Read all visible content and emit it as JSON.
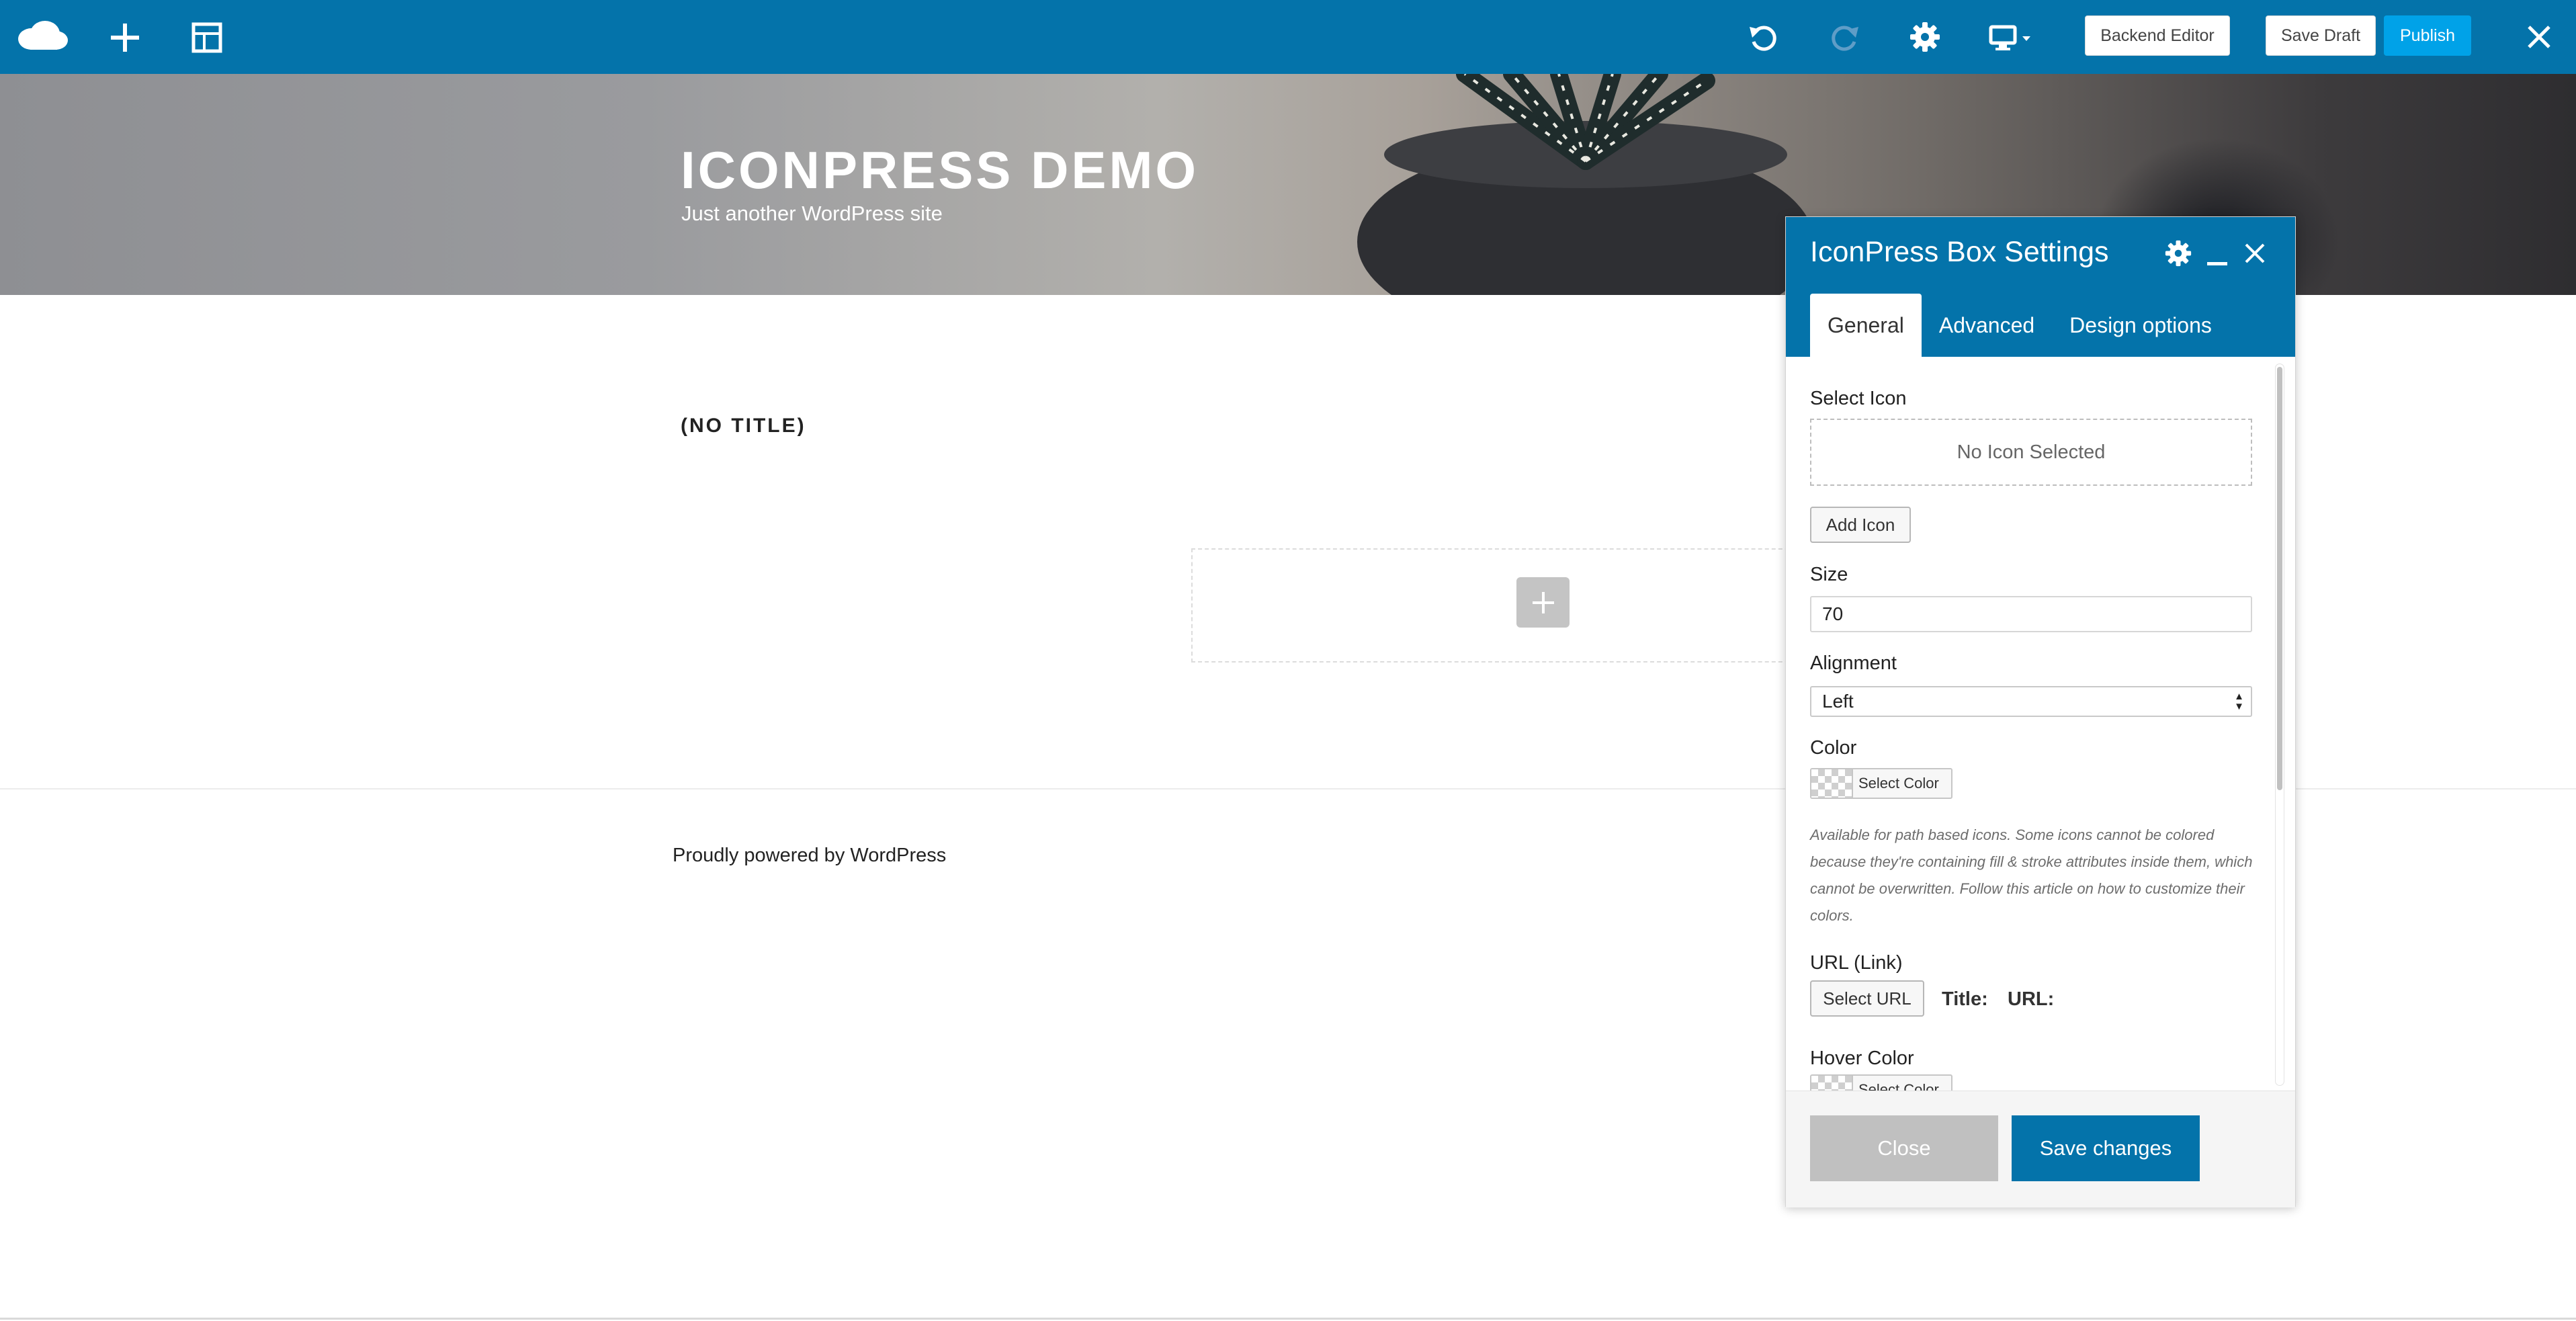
{
  "toolbar": {
    "logo_icon": "cloud-logo-icon",
    "add_icon": "plus-icon",
    "templates_icon": "templates-icon",
    "undo_icon": "undo-icon",
    "redo_icon": "redo-icon",
    "settings_icon": "gear-icon",
    "responsive_icon": "monitor-icon",
    "backend_editor_label": "Backend Editor",
    "save_draft_label": "Save Draft",
    "publish_label": "Publish",
    "close_icon": "close-icon",
    "bar_color": "#0473aa",
    "publish_color": "#00a2e8"
  },
  "site": {
    "title": "ICONPRESS DEMO",
    "description": "Just another WordPress site"
  },
  "post": {
    "title": "(NO TITLE)"
  },
  "footer": {
    "text": "Proudly powered by WordPress"
  },
  "panel": {
    "title": "IconPress Box Settings",
    "tabs": [
      {
        "label": "General",
        "active": true
      },
      {
        "label": "Advanced",
        "active": false
      },
      {
        "label": "Design options",
        "active": false
      }
    ],
    "fields": {
      "select_icon_label": "Select Icon",
      "no_icon_text": "No Icon Selected",
      "add_icon_label": "Add Icon",
      "size_label": "Size",
      "size_value": "70",
      "alignment_label": "Alignment",
      "alignment_value": "Left",
      "color_label": "Color",
      "select_color_label": "Select Color",
      "color_help": "Available for path based icons. Some icons cannot be colored because they're containing fill & stroke attributes inside them, which cannot be overwritten. Follow this article on how to customize their colors.",
      "url_label": "URL (Link)",
      "select_url_label": "Select URL",
      "url_title_label": "Title:",
      "url_url_label": "URL:",
      "hover_color_label": "Hover Color",
      "hover_select_color_label": "Select Color"
    },
    "footer": {
      "close_label": "Close",
      "save_label": "Save changes"
    }
  }
}
